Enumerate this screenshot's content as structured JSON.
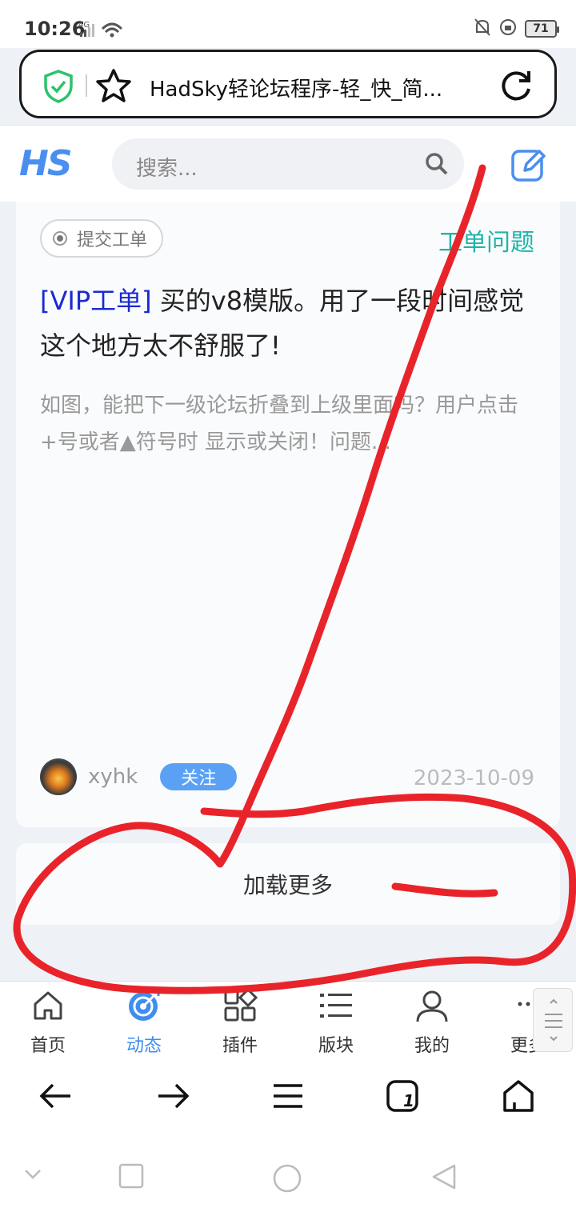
{
  "status_bar": {
    "time": "10:26",
    "network": "4G",
    "battery": "71"
  },
  "browser": {
    "page_title": "HadSky轻论坛程序-轻_快_简..."
  },
  "site": {
    "logo": "HS",
    "search_placeholder": "搜索..."
  },
  "post": {
    "tag": "提交工单",
    "category": "工单问题",
    "title_prefix": "[VIP工单]",
    "title": " 买的v8模版。用了一段时间感觉这个地方太不舒服了!",
    "excerpt": "如图，能把下一级论坛折叠到上级里面吗？用户点击+号或者▲符号时 显示或关闭！问题...",
    "author": "xyhk",
    "follow_label": "关注",
    "date": "2023-10-09"
  },
  "load_more": "加载更多",
  "tabs": [
    {
      "label": "首页",
      "icon": "home-icon"
    },
    {
      "label": "动态",
      "icon": "target-icon"
    },
    {
      "label": "插件",
      "icon": "grid-icon"
    },
    {
      "label": "版块",
      "icon": "list-icon"
    },
    {
      "label": "我的",
      "icon": "user-icon"
    },
    {
      "label": "更多",
      "icon": "more-icon"
    }
  ],
  "browser_nav": {
    "tab_count": "1"
  },
  "colors": {
    "accent": "#3d8ef0",
    "category": "#1fb5a8",
    "vip": "#1a2ad0",
    "annotation": "#e8242a"
  }
}
